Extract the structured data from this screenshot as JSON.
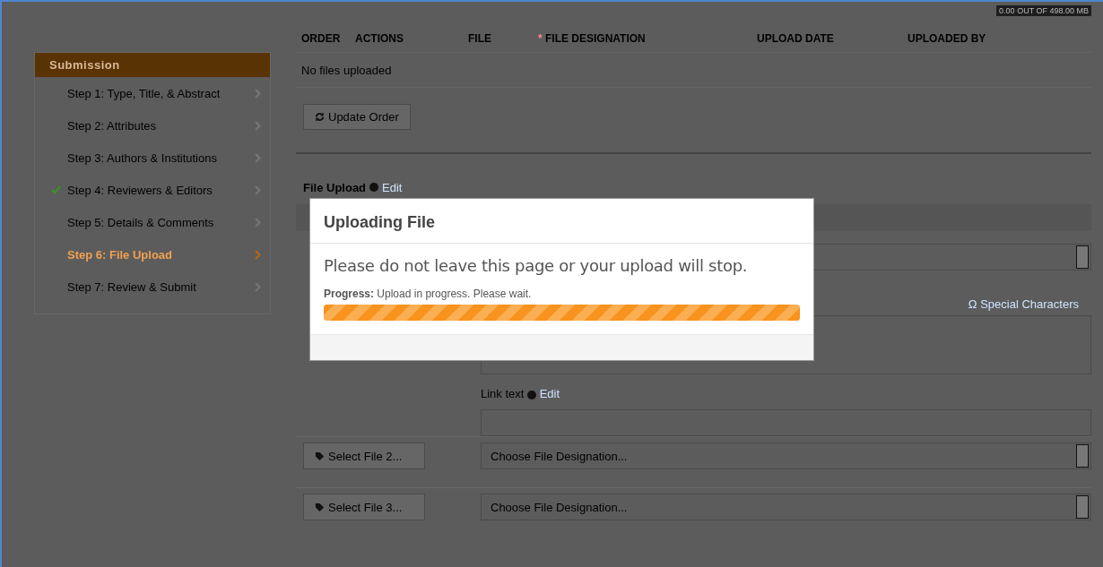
{
  "sidebar": {
    "title": "Submission",
    "steps": [
      {
        "label": "Step 1: Type, Title, & Abstract",
        "selected": false,
        "completed": false
      },
      {
        "label": "Step 2: Attributes",
        "selected": false,
        "completed": false
      },
      {
        "label": "Step 3: Authors & Institutions",
        "selected": false,
        "completed": false
      },
      {
        "label": "Step 4: Reviewers & Editors",
        "selected": false,
        "completed": true
      },
      {
        "label": "Step 5: Details & Comments",
        "selected": false,
        "completed": false
      },
      {
        "label": "Step 6: File Upload",
        "selected": true,
        "completed": false
      },
      {
        "label": "Step 7: Review & Submit",
        "selected": false,
        "completed": false
      }
    ]
  },
  "storage_badge": "0.00 OUT OF 498.00 MB",
  "table": {
    "columns": [
      {
        "label": "ORDER"
      },
      {
        "label": "ACTIONS"
      },
      {
        "label": "FILE"
      },
      {
        "label": "FILE DESIGNATION",
        "required_mark": "*"
      },
      {
        "label": "UPLOAD DATE"
      },
      {
        "label": "UPLOADED BY"
      }
    ],
    "empty_text": "No files uploaded"
  },
  "update_button": "Update Order",
  "file_upload": {
    "label": "File Upload",
    "edit": "Edit",
    "special_characters": "Ω Special Characters",
    "link_text_label": "Link text",
    "link_text_edit": "Edit",
    "rows": [
      {
        "button": "Select File 2...",
        "placeholder": "Choose File Designation..."
      },
      {
        "button": "Select File 3...",
        "placeholder": "Choose File Designation..."
      }
    ]
  },
  "modal": {
    "title": "Uploading File",
    "message": "Please do not leave this page or your upload will stop.",
    "progress_label": "Progress:",
    "progress_text": "Upload in progress. Please wait.",
    "level": 1
  }
}
